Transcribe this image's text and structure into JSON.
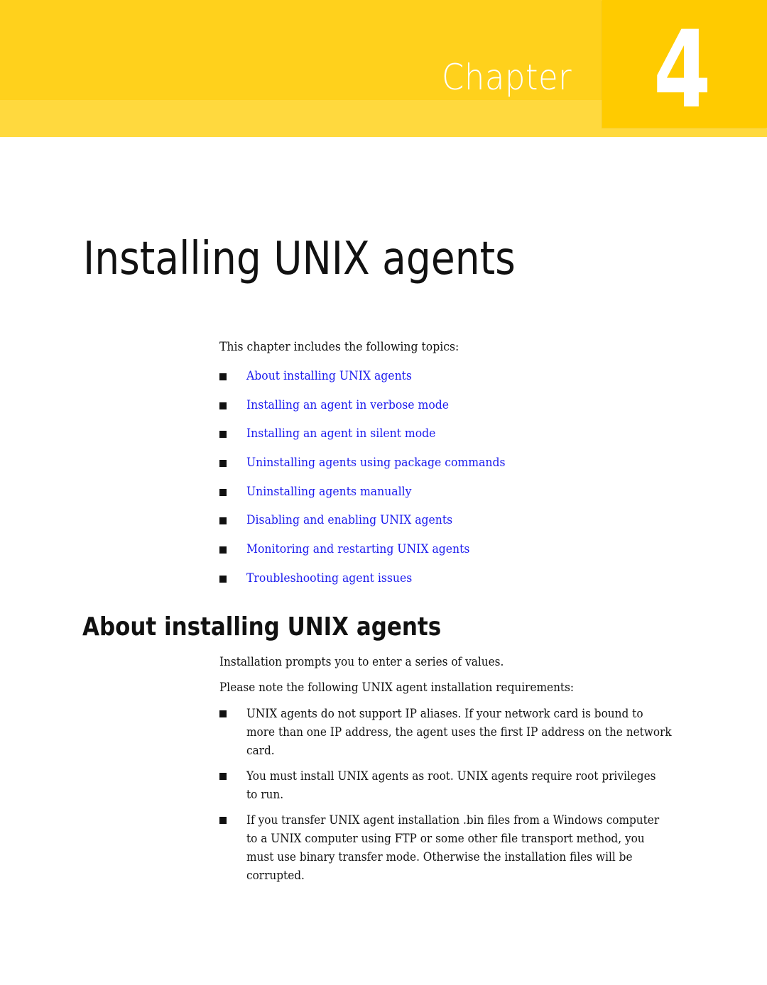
{
  "banner": {
    "chapter_label": "Chapter",
    "chapter_number": "4",
    "colors": {
      "banner": "#ffd11c",
      "band": "#ffd93e",
      "number_box": "#ffcb00",
      "text": "#ffffff"
    }
  },
  "page_title": "Installing UNIX agents",
  "intro": "This chapter includes the following topics:",
  "link_color": "#1a1aee",
  "topics": [
    {
      "label": "About installing UNIX agents"
    },
    {
      "label": "Installing an agent in verbose mode"
    },
    {
      "label": "Installing an agent in silent mode"
    },
    {
      "label": "Uninstalling agents using package commands"
    },
    {
      "label": "Uninstalling agents manually"
    },
    {
      "label": "Disabling and enabling UNIX agents"
    },
    {
      "label": "Monitoring and restarting UNIX agents"
    },
    {
      "label": "Troubleshooting agent issues"
    }
  ],
  "section": {
    "heading": "About installing UNIX agents",
    "paragraphs": [
      "Installation prompts you to enter a series of values.",
      "Please note the following UNIX agent installation requirements:"
    ],
    "requirements": [
      {
        "lines": [
          "UNIX agents do not support IP aliases. If your network card is bound to",
          "more than one IP address, the agent uses the first IP address on the network",
          "card."
        ]
      },
      {
        "lines": [
          "You must install UNIX agents as root. UNIX agents require root privileges",
          "to run."
        ]
      },
      {
        "lines": [
          "If you transfer UNIX agent installation .bin files from a Windows computer",
          "to a UNIX computer using FTP or some other file transport method, you",
          "must use binary transfer mode. Otherwise the installation files will be",
          "corrupted."
        ]
      }
    ]
  }
}
